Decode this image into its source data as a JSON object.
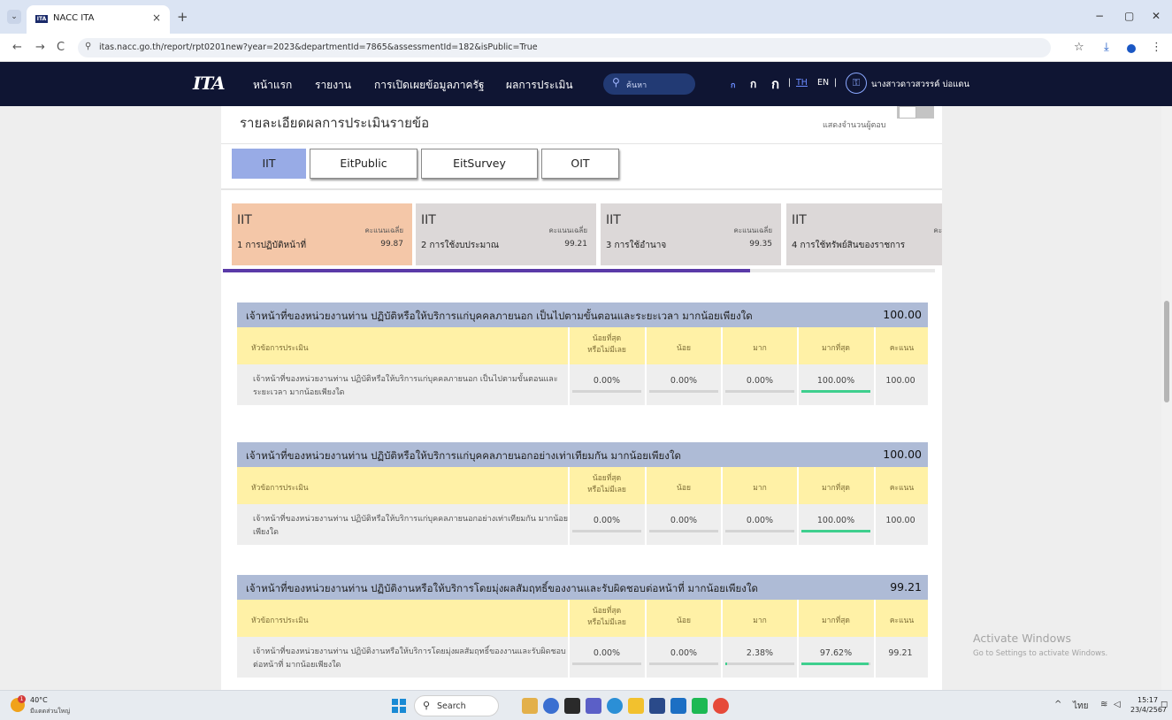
{
  "browser": {
    "tab_title": "NACC ITA",
    "tab_favicon": "ITA",
    "url": "itas.nacc.go.th/report/rpt0201new?year=2023&departmentId=7865&assessmentId=182&isPublic=True",
    "new_tab": "+",
    "close": "×",
    "back": "←",
    "forward": "→",
    "reload": "C",
    "star": "☆",
    "download": "⤓",
    "menu": "⋮",
    "win_min": "−",
    "win_restore": "▢",
    "win_close": "✕"
  },
  "site_nav": {
    "logo": "ITA",
    "links": [
      "หน้าแรก",
      "รายงาน",
      "การเปิดเผยข้อมูลภาครัฐ",
      "ผลการประเมิน"
    ],
    "search_placeholder": "ค้นหา",
    "font_sizes": [
      "ก",
      "ก",
      "ก"
    ],
    "lang_sep": "|",
    "lang_th": "TH",
    "lang_en": "EN",
    "user_name": "นางสาวดาวสวรรค์ บ่อแดน"
  },
  "page": {
    "section_title": "รายละเอียดผลการประเมินรายข้อ",
    "toggle_label": "แสดงจำนวนผู้ตอบ",
    "type_tabs": [
      "IIT",
      "EitPublic",
      "EitSurvey",
      "OIT"
    ],
    "active_type_tab": "IIT",
    "cards": [
      {
        "code": "IIT",
        "avg_label": "คะแนนเฉลี่ย",
        "name": "1 การปฏิบัติหน้าที่",
        "value": "99.87"
      },
      {
        "code": "IIT",
        "avg_label": "คะแนนเฉลี่ย",
        "name": "2 การใช้งบประมาณ",
        "value": "99.21"
      },
      {
        "code": "IIT",
        "avg_label": "คะแนนเฉลี่ย",
        "name": "3 การใช้อำนาจ",
        "value": "99.35"
      },
      {
        "code": "IIT",
        "avg_label": "คะ",
        "name": "4 การใช้ทรัพย์สินของราชการ",
        "value": ""
      }
    ],
    "progress_fraction": 0.74,
    "table_headers": {
      "topic": "หัวข้อการประเมิน",
      "least": [
        "น้อยที่สุด",
        "หรือไม่มีเลย"
      ],
      "low": "น้อย",
      "high": "มาก",
      "highest": "มากที่สุด",
      "score": "คะแนน"
    },
    "questions": [
      {
        "title": "เจ้าหน้าที่ของหน่วยงานท่าน ปฏิบัติหรือให้บริการแก่บุคคลภายนอก เป็นไปตามขั้นตอนและระยะเวลา มากน้อยเพียงใด",
        "score": "100.00",
        "row_text": "เจ้าหน้าที่ของหน่วยงานท่าน ปฏิบัติหรือให้บริการแก่บุคคลภายนอก เป็นไปตามขั้นตอนและระยะเวลา มากน้อยเพียงใด",
        "pcts": [
          "0.00%",
          "0.00%",
          "0.00%",
          "100.00%"
        ],
        "fracs": [
          0,
          0,
          0,
          1.0
        ],
        "row_score": "100.00"
      },
      {
        "title": "เจ้าหน้าที่ของหน่วยงานท่าน ปฏิบัติหรือให้บริการแก่บุคคลภายนอกอย่างเท่าเทียมกัน มากน้อยเพียงใด",
        "score": "100.00",
        "row_text": "เจ้าหน้าที่ของหน่วยงานท่าน ปฏิบัติหรือให้บริการแก่บุคคลภายนอกอย่างเท่าเทียมกัน มากน้อยเพียงใด",
        "pcts": [
          "0.00%",
          "0.00%",
          "0.00%",
          "100.00%"
        ],
        "fracs": [
          0,
          0,
          0,
          1.0
        ],
        "row_score": "100.00"
      },
      {
        "title": "เจ้าหน้าที่ของหน่วยงานท่าน ปฏิบัติงานหรือให้บริการโดยมุ่งผลสัมฤทธิ์ของงานและรับผิดชอบต่อหน้าที่ มากน้อยเพียงใด",
        "score": "99.21",
        "row_text": "เจ้าหน้าที่ของหน่วยงานท่าน ปฏิบัติงานหรือให้บริการโดยมุ่งผลสัมฤทธิ์ของงานและรับผิดชอบต่อหน้าที่ มากน้อยเพียงใด",
        "pcts": [
          "0.00%",
          "0.00%",
          "2.38%",
          "97.62%"
        ],
        "fracs": [
          0,
          0,
          0.0238,
          0.9762
        ],
        "row_score": "99.21"
      }
    ]
  },
  "windows": {
    "activate_title": "Activate Windows",
    "activate_sub": "Go to Settings to activate Windows."
  },
  "taskbar": {
    "weather_temp": "40°C",
    "weather_badge": "1",
    "weather_desc": "มีแดดส่วนใหญ่",
    "search": "Search",
    "tray_lang": "ไทย",
    "time": "15:17",
    "date": "23/4/2567"
  },
  "colors": {
    "nav_bg": "#0f1533",
    "active_tab": "#98abe6",
    "active_card": "#f4c7a8",
    "question_header": "#aebbd6",
    "table_header": "#fff1a6",
    "bar_fill": "#3ecf8e",
    "progress": "#5a3aa8"
  }
}
